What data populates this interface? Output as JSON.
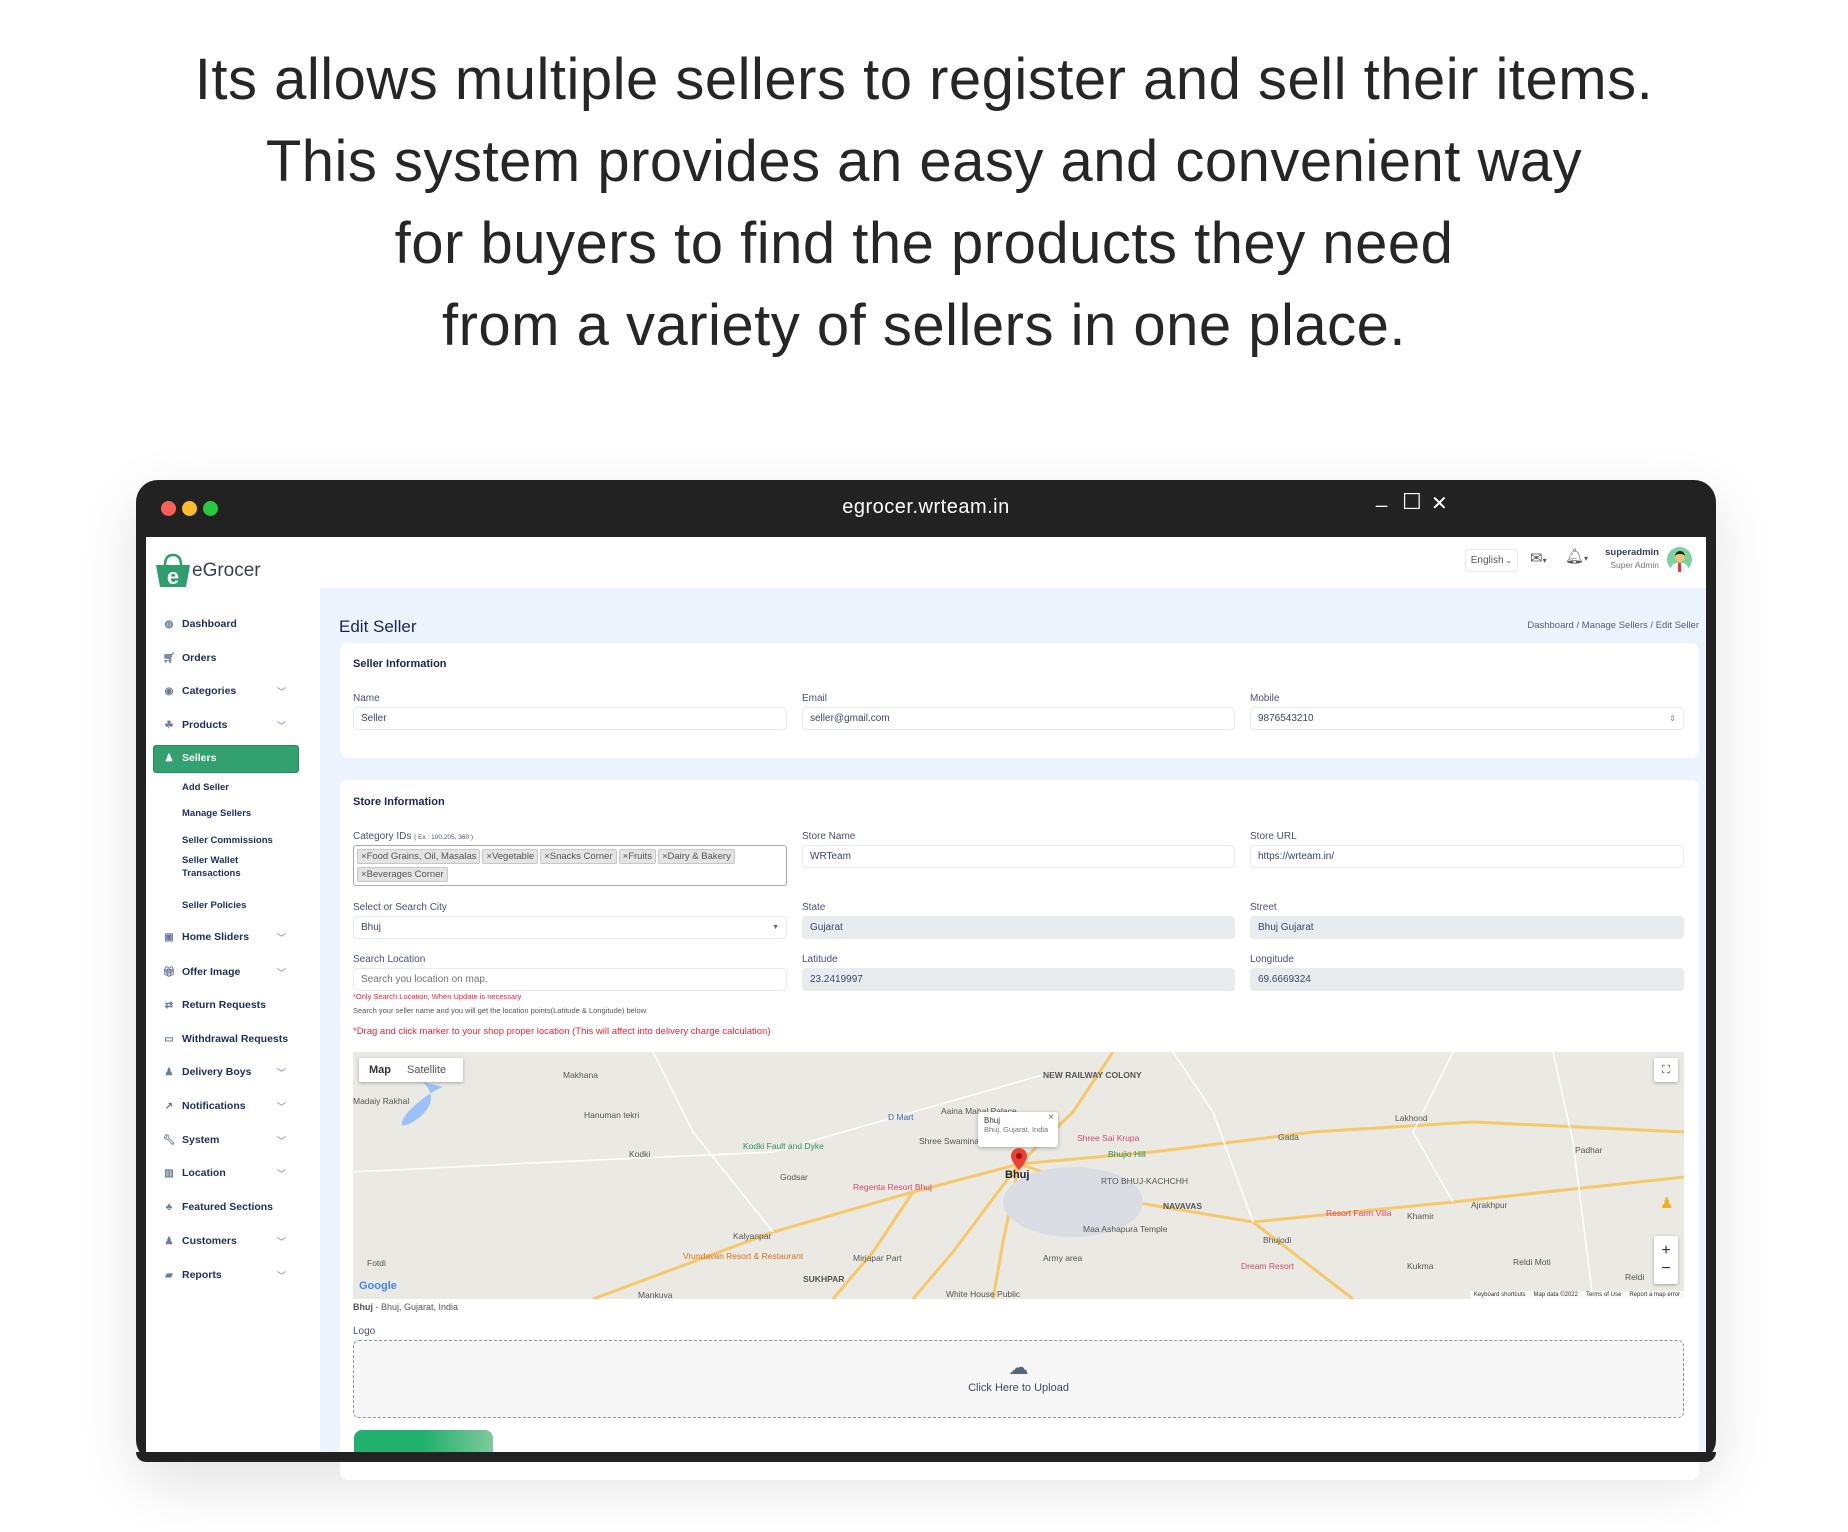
{
  "headline": {
    "lines": [
      "Its allows multiple sellers to register and sell their items.",
      "This system provides an easy and convenient way",
      "for buyers to find the products they need",
      "from a variety of sellers in one place."
    ]
  },
  "window": {
    "title": "egrocer.wrteam.in",
    "controls": {
      "minimize": "_",
      "maximize": "☐",
      "close": "✕"
    }
  },
  "brand": {
    "name": "eGrocer",
    "color": "#2e9e6e"
  },
  "header": {
    "language": "English",
    "user_name": "superadmin",
    "user_role": "Super Admin"
  },
  "sidebar": {
    "items": [
      {
        "label": "Dashboard",
        "icon": "dashboard-icon"
      },
      {
        "label": "Orders",
        "icon": "cart-icon"
      },
      {
        "label": "Categories",
        "icon": "categories-icon"
      },
      {
        "label": "Products",
        "icon": "products-icon"
      },
      {
        "label": "Sellers",
        "icon": "seller-icon",
        "active": true
      },
      {
        "label": "Home Sliders",
        "icon": "image-icon"
      },
      {
        "label": "Offer Image",
        "icon": "gift-icon"
      },
      {
        "label": "Return Requests",
        "icon": "return-icon"
      },
      {
        "label": "Withdrawal Requests",
        "icon": "card-icon"
      },
      {
        "label": "Delivery Boys",
        "icon": "person-icon"
      },
      {
        "label": "Notifications",
        "icon": "share-icon"
      },
      {
        "label": "System",
        "icon": "wrench-icon"
      },
      {
        "label": "Location",
        "icon": "map-icon"
      },
      {
        "label": "Featured Sections",
        "icon": "sections-icon"
      },
      {
        "label": "Customers",
        "icon": "person-icon"
      },
      {
        "label": "Reports",
        "icon": "folder-icon"
      }
    ],
    "sellers_sub": [
      "Add Seller",
      "Manage Sellers",
      "Seller Commissions",
      "Seller Wallet Transactions",
      "Seller Policies"
    ]
  },
  "page": {
    "title": "Edit Seller",
    "breadcrumb": [
      "Dashboard",
      "Manage Sellers",
      "Edit Seller"
    ],
    "breadcrumb_sep": "/"
  },
  "seller_info": {
    "title": "Seller Information",
    "name_label": "Name",
    "name": "Seller",
    "email_label": "Email",
    "email": "seller@gmail.com",
    "mobile_label": "Mobile",
    "mobile": "9876543210"
  },
  "store_info": {
    "title": "Store Information",
    "category_label": "Category IDs",
    "category_hint": "( Ex : 100,205, 360 )",
    "categories": [
      "Food Grains, Oil, Masalas",
      "Vegetable",
      "Snacks Corner",
      "Fruits",
      "Dairy & Bakery",
      "Beverages Corner"
    ],
    "store_name_label": "Store Name",
    "store_name": "WRTeam",
    "store_url_label": "Store URL",
    "store_url": "https://wrteam.in/",
    "city_label": "Select or Search City",
    "city": "Bhuj",
    "state_label": "State",
    "state": "Gujarat",
    "street_label": "Street",
    "street": "Bhuj  Gujarat",
    "search_label": "Search Location",
    "search_placeholder": "Search you location on map.",
    "latitude_label": "Latitude",
    "latitude": "23.2419997",
    "longitude_label": "Longitude",
    "longitude": "69.6669324",
    "note_red": "*Only Search Location, When Update is necessary",
    "note_gray": "Search your seller name and you will get the location points(Latitude & Longitude) below.",
    "note_drag": "*Drag and click marker to your shop proper location (This will affect into delivery charge calculation)",
    "map_caption_bold": "Bhuj",
    "map_caption": " - Bhuj, Gujarat, India",
    "logo_label": "Logo",
    "upload_text": "Click Here to Upload"
  },
  "map": {
    "type_map": "Map",
    "type_satellite": "Satellite",
    "popup_title": "Bhuj",
    "popup_sub": "Bhuj, Gujarat, India",
    "popup_close": "×",
    "center_label": "Bhuj",
    "zoom_in": "+",
    "zoom_out": "−",
    "google": "Google",
    "footer": [
      "Keyboard shortcuts",
      "Map data ©2022",
      "Terms of Use",
      "Report a map error"
    ],
    "labels": [
      "Makhana",
      "Hanuman tekri",
      "Kodki",
      "Kodki Fault and Dyke",
      "Godsar",
      "Regenta Resort Bhuj",
      "D Mart",
      "Aaina Mahal Palace",
      "NEW RAILWAY COLONY",
      "Shree Swaminarayan Temple Bhuj",
      "Shree Sai Krupa",
      "Bhujio Hill",
      "RTO BHUJ-KACHCHH",
      "NAVAVAS",
      "Maa Ashapura Temple",
      "Army area",
      "Kalyanpar",
      "Vrundavan Resort & Restaurant",
      "Mirjapar Part",
      "SUKHPAR",
      "White House Public",
      "Lakhond",
      "Gada",
      "Padhar",
      "Resort Farm Villa",
      "Khamir",
      "Ajrakhpur",
      "Bhujodi",
      "Dream Resort",
      "Kukma",
      "Reldi Moti",
      "Reldi",
      "Fotdi",
      "Madaiy Rakhal",
      "Mankuva"
    ]
  }
}
